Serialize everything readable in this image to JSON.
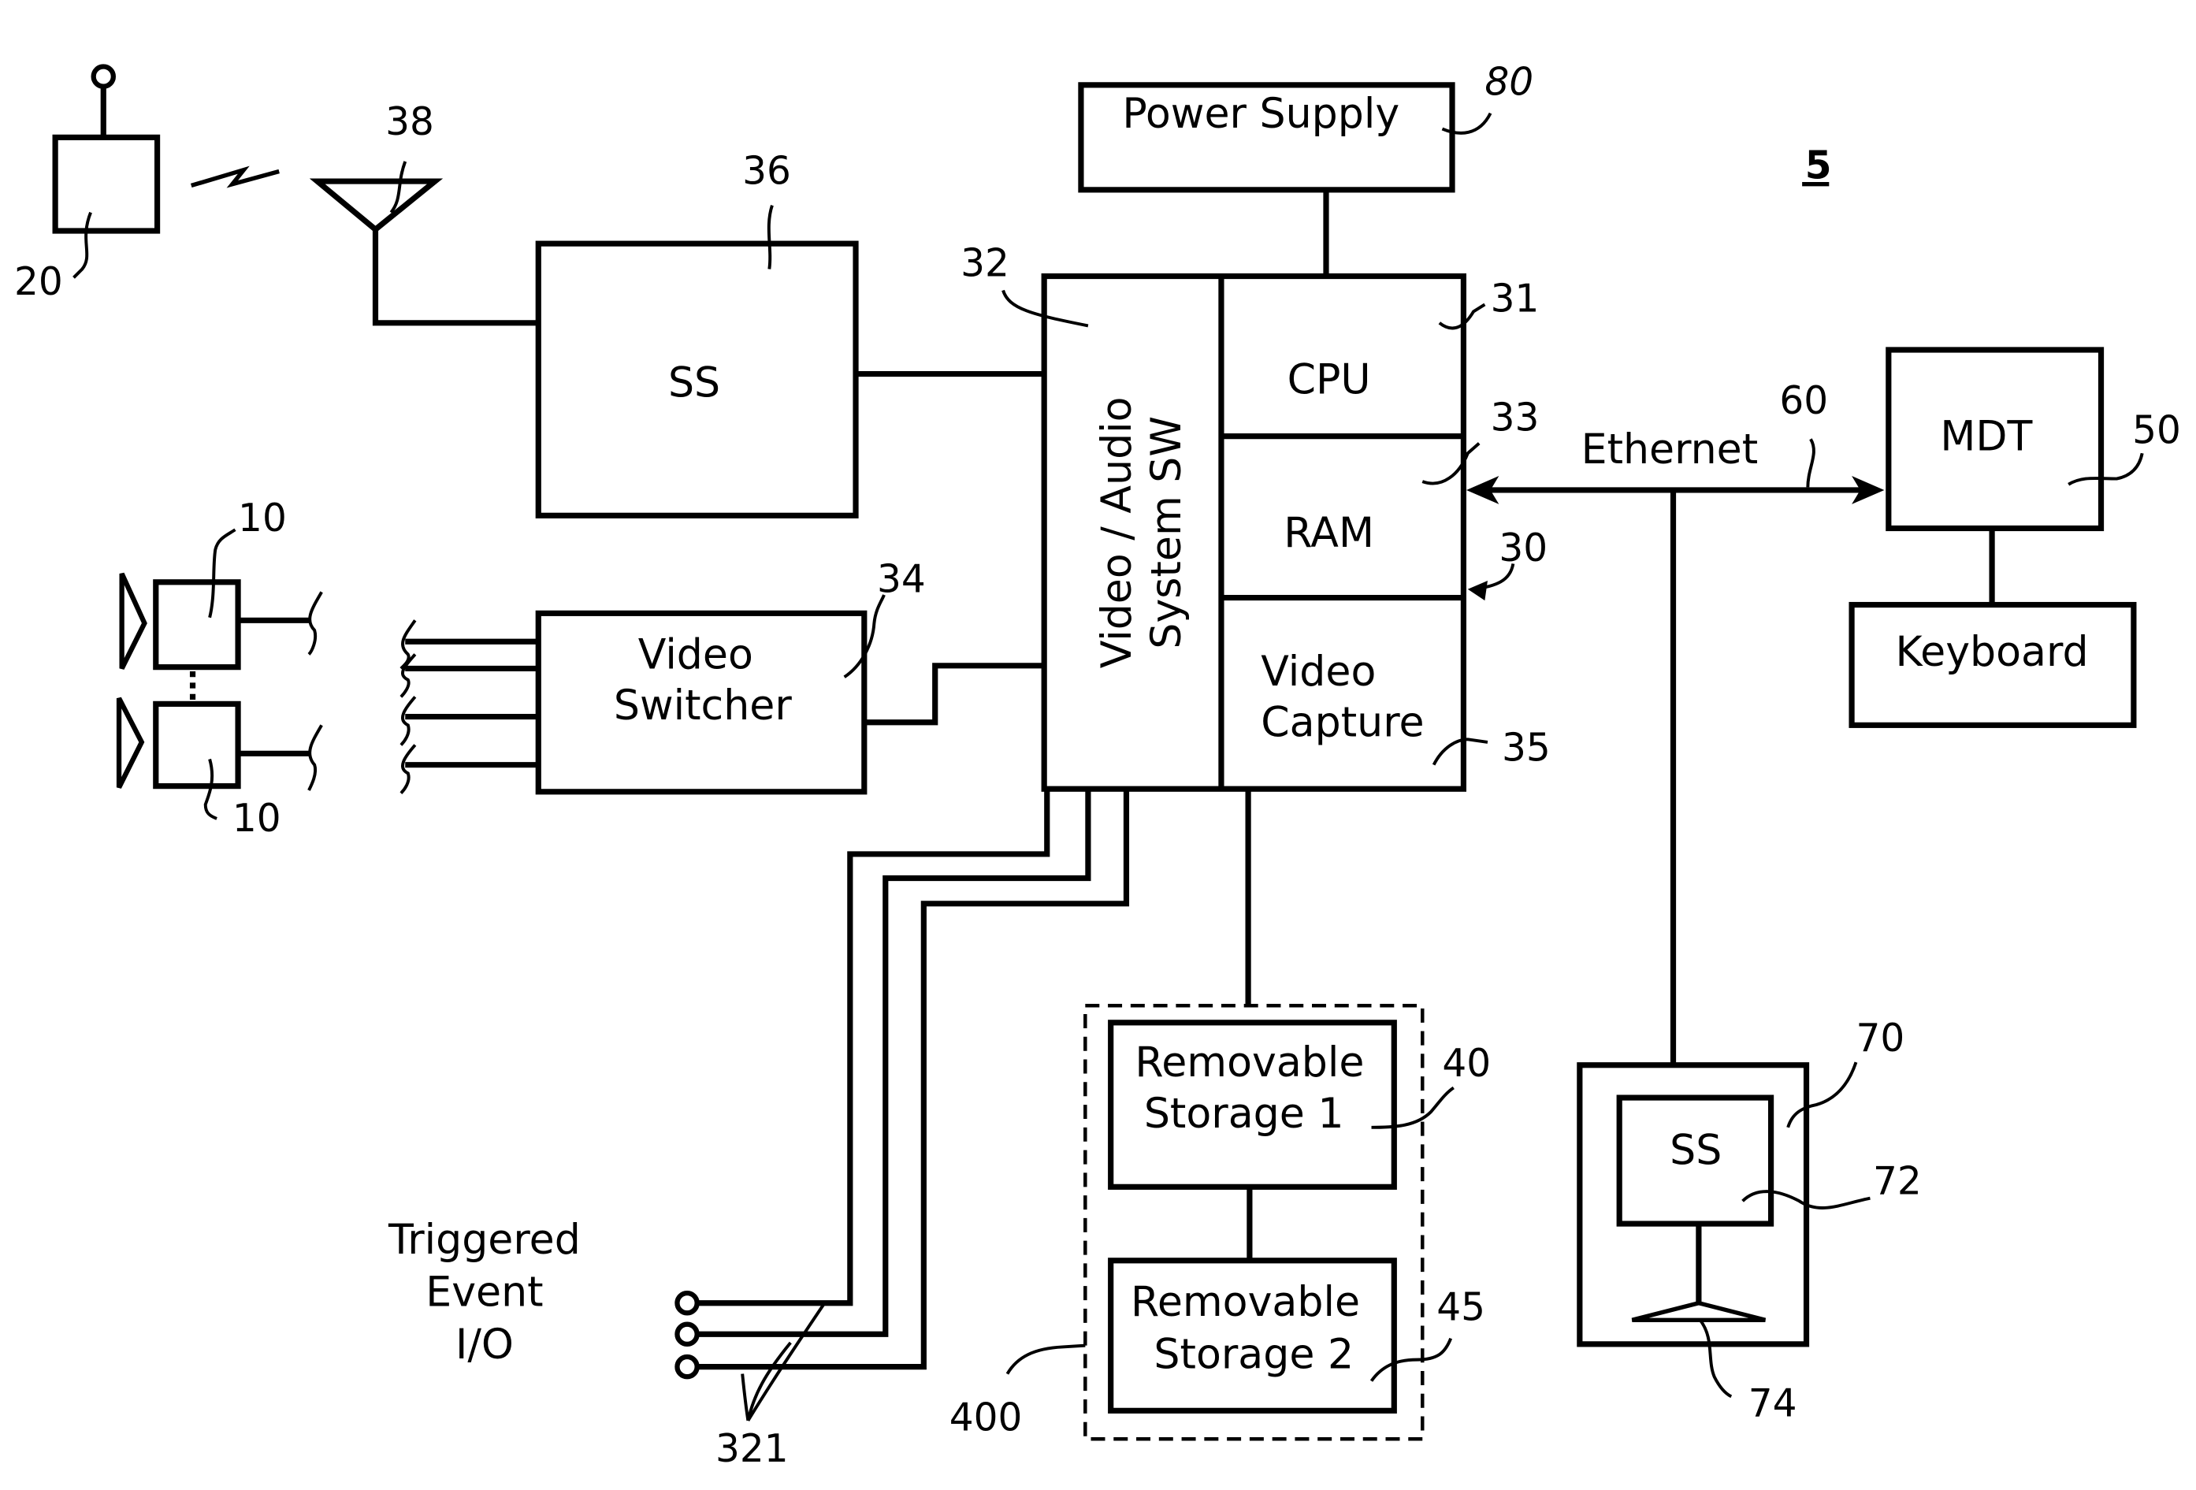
{
  "figure": {
    "number": "5",
    "colors": {
      "ink": "#000000",
      "paper": "#ffffff"
    }
  },
  "blocks": {
    "power_supply": {
      "label": "Power Supply",
      "ref": "80"
    },
    "subscriber_station": {
      "label": "SS",
      "ref": "36"
    },
    "video_switcher": {
      "label_line1": "Video",
      "label_line2": "Switcher",
      "ref": "34"
    },
    "av_system_sw": {
      "label_line1": "Video / Audio",
      "label_line2": "System SW",
      "ref": "32"
    },
    "cpu": {
      "label": "CPU",
      "ref": "31"
    },
    "ram": {
      "label": "RAM",
      "ref": "33"
    },
    "video_capture": {
      "label_line1": "Video",
      "label_line2": "Capture",
      "ref": "35"
    },
    "computer_unit": {
      "ref": "30"
    },
    "mdt": {
      "label": "MDT",
      "ref": "50"
    },
    "keyboard": {
      "label": "Keyboard"
    },
    "removable_storage_1": {
      "label_line1": "Removable",
      "label_line2": "Storage 1",
      "ref": "40"
    },
    "removable_storage_2": {
      "label_line1": "Removable",
      "label_line2": "Storage 2",
      "ref": "45"
    },
    "storage_group": {
      "ref": "400"
    },
    "remote_station": {
      "ref": "70"
    },
    "remote_ss": {
      "label": "SS",
      "ref": "72"
    },
    "remote_antenna": {
      "ref": "74"
    }
  },
  "peripherals": {
    "remote_device": {
      "ref": "20"
    },
    "antenna": {
      "ref": "38"
    },
    "camera_top": {
      "ref": "10"
    },
    "camera_bottom": {
      "ref": "10"
    }
  },
  "links": {
    "ethernet": {
      "label": "Ethernet",
      "ref": "60"
    }
  },
  "triggered_event_io": {
    "label_line1": "Triggered",
    "label_line2": "Event",
    "label_line3": "I/O",
    "ref": "321"
  }
}
